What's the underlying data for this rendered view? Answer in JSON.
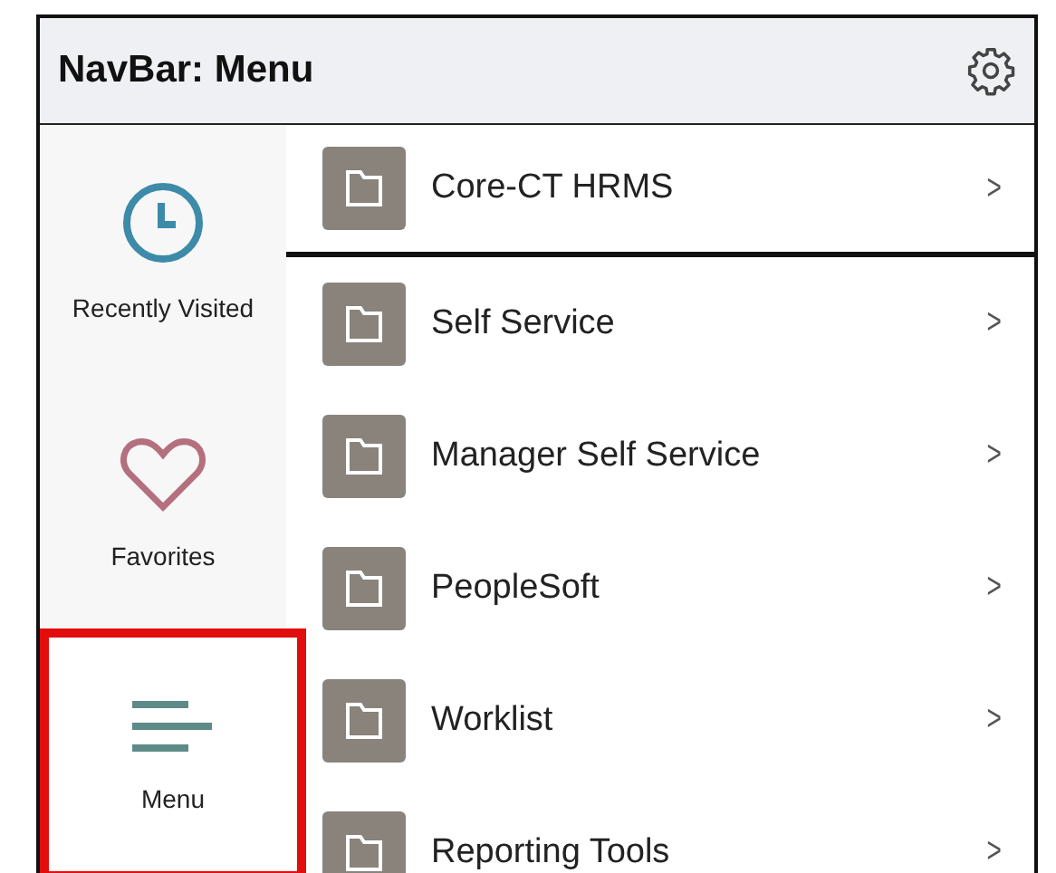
{
  "header": {
    "title": "NavBar: Menu"
  },
  "sidebar": {
    "items": [
      {
        "kind": "clock",
        "label": "Recently Visited",
        "selected": false
      },
      {
        "kind": "heart",
        "label": "Favorites",
        "selected": false
      },
      {
        "kind": "menu",
        "label": "Menu",
        "selected": true
      }
    ]
  },
  "menu": {
    "items": [
      {
        "label": "Core-CT HRMS",
        "chevron": ">",
        "selected": true
      },
      {
        "label": "Self Service",
        "chevron": ">",
        "selected": false
      },
      {
        "label": "Manager Self Service",
        "chevron": ">",
        "selected": false
      },
      {
        "label": "PeopleSoft",
        "chevron": ">",
        "selected": false
      },
      {
        "label": "Worklist",
        "chevron": ">",
        "selected": false
      },
      {
        "label": "Reporting Tools",
        "chevron": ">",
        "selected": false
      }
    ]
  }
}
